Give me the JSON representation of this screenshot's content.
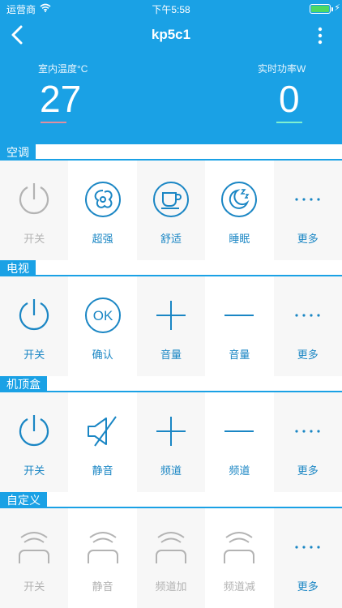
{
  "status": {
    "carrier": "运营商",
    "time": "下午5:58"
  },
  "header": {
    "title": "kp5c1"
  },
  "metrics": {
    "indoor_temp_label": "室内温度°C",
    "indoor_temp_value": "27",
    "power_label": "实时功率W",
    "power_value": "0"
  },
  "sections": [
    {
      "title": "空调",
      "items": [
        {
          "label": "开关",
          "icon": "power-icon",
          "disabled": true
        },
        {
          "label": "超强",
          "icon": "swirl-icon",
          "disabled": false
        },
        {
          "label": "舒适",
          "icon": "cup-icon",
          "disabled": false
        },
        {
          "label": "睡眠",
          "icon": "sleep-moon-icon",
          "disabled": false
        },
        {
          "label": "更多",
          "icon": "more-dots-icon",
          "disabled": false
        }
      ]
    },
    {
      "title": "电视",
      "items": [
        {
          "label": "开关",
          "icon": "power-icon",
          "disabled": false
        },
        {
          "label": "确认",
          "icon": "ok-icon",
          "disabled": false
        },
        {
          "label": "音量",
          "icon": "plus-icon",
          "disabled": false
        },
        {
          "label": "音量",
          "icon": "minus-icon",
          "disabled": false
        },
        {
          "label": "更多",
          "icon": "more-dots-icon",
          "disabled": false
        }
      ]
    },
    {
      "title": "机顶盒",
      "items": [
        {
          "label": "开关",
          "icon": "power-icon",
          "disabled": false
        },
        {
          "label": "静音",
          "icon": "mute-icon",
          "disabled": false
        },
        {
          "label": "频道",
          "icon": "plus-icon",
          "disabled": false
        },
        {
          "label": "频道",
          "icon": "minus-icon",
          "disabled": false
        },
        {
          "label": "更多",
          "icon": "more-dots-icon",
          "disabled": false
        }
      ]
    },
    {
      "title": "自定义",
      "items": [
        {
          "label": "开关",
          "icon": "signal-icon",
          "disabled": true
        },
        {
          "label": "静音",
          "icon": "signal-icon",
          "disabled": true
        },
        {
          "label": "频道加",
          "icon": "signal-icon",
          "disabled": true
        },
        {
          "label": "频道减",
          "icon": "signal-icon",
          "disabled": true
        },
        {
          "label": "更多",
          "icon": "more-dots-icon",
          "disabled": false
        }
      ]
    }
  ],
  "colors": {
    "accent": "#1aa1e5",
    "icon": "#1a86c4",
    "disabled": "#b3b3b3",
    "temp_underline": "#e08fa0",
    "power_underline": "#7ef0d0"
  }
}
